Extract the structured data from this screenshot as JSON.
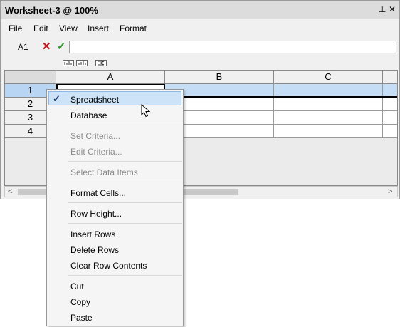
{
  "window": {
    "title": "Worksheet-3 @ 100%",
    "pin_glyph": "⊥",
    "close_glyph": "✕"
  },
  "menubar": [
    "File",
    "Edit",
    "View",
    "Insert",
    "Format"
  ],
  "formula_bar": {
    "cell_ref": "A1",
    "cancel_glyph": "✕",
    "accept_glyph": "✓",
    "formula_value": ""
  },
  "toolbar_icons": [
    "chart-bar-icon",
    "chart-column-icon",
    "sum-icon"
  ],
  "grid": {
    "columns": [
      "A",
      "B",
      "C"
    ],
    "rows": [
      "1",
      "2",
      "3",
      "4"
    ],
    "selected_row": "1",
    "active_cell": "A1"
  },
  "scrollbar": {
    "left_arrow": "<",
    "right_arrow": ">"
  },
  "context_menu": {
    "checked_glyph": "✓",
    "items": [
      {
        "label": "Spreadsheet",
        "checked": true,
        "enabled": true,
        "highlighted": true
      },
      {
        "label": "Database",
        "enabled": true
      },
      {
        "label": "Set Criteria...",
        "enabled": false
      },
      {
        "label": "Edit Criteria...",
        "enabled": false
      },
      {
        "label": "Select Data Items",
        "enabled": false
      },
      {
        "label": "Format Cells...",
        "enabled": true
      },
      {
        "label": "Row Height...",
        "enabled": true
      },
      {
        "label": "Insert Rows",
        "enabled": true
      },
      {
        "label": "Delete Rows",
        "enabled": true
      },
      {
        "label": "Clear Row Contents",
        "enabled": true
      },
      {
        "label": "Cut",
        "enabled": true
      },
      {
        "label": "Copy",
        "enabled": true
      },
      {
        "label": "Paste",
        "enabled": true
      }
    ]
  },
  "colors": {
    "selection": "#cde3f7",
    "row_selected": "#b8d6f4",
    "cancel": "#c0181a",
    "accept": "#2f9a2f"
  }
}
